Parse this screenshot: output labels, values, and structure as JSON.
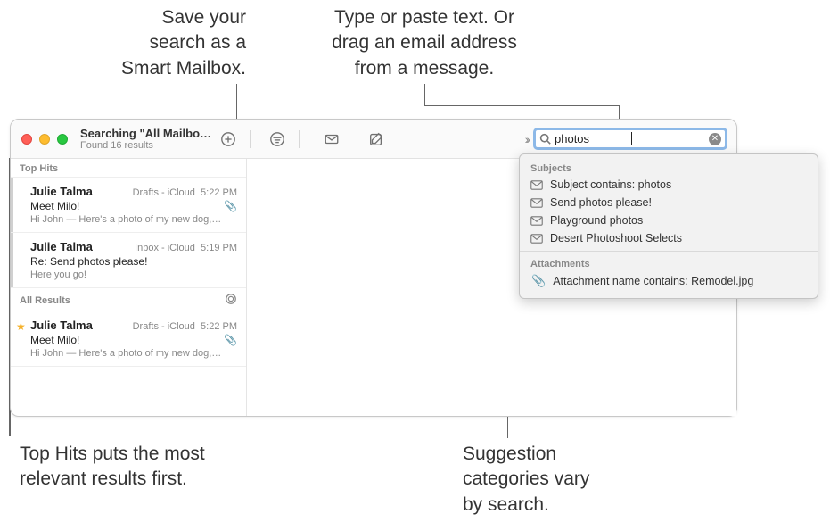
{
  "callouts": {
    "smartMailbox": "Save your\nsearch as a\nSmart Mailbox.",
    "searchHint": "Type or paste text. Or\ndrag an email address\nfrom a message.",
    "topHits": "Top Hits puts the most\nrelevant results first.",
    "suggestions": "Suggestion\ncategories vary\nby search."
  },
  "window": {
    "title": "Searching \"All Mailbo…",
    "subtitle": "Found 16 results"
  },
  "search": {
    "value": "photos"
  },
  "sections": {
    "topHits": "Top Hits",
    "allResults": "All Results"
  },
  "messages": {
    "topHits": [
      {
        "sender": "Julie Talma",
        "folder": "Drafts - iCloud",
        "time": "5:22 PM",
        "subject": "Meet Milo!",
        "hasAttachment": true,
        "preview": "Hi John — Here's a photo of my new dog,…"
      },
      {
        "sender": "Julie Talma",
        "folder": "Inbox - iCloud",
        "time": "5:19 PM",
        "subject": "Re: Send photos please!",
        "hasAttachment": false,
        "preview": "Here you go!"
      }
    ],
    "allResults": [
      {
        "starred": true,
        "sender": "Julie Talma",
        "folder": "Drafts - iCloud",
        "time": "5:22 PM",
        "subject": "Meet Milo!",
        "hasAttachment": true,
        "preview": "Hi John — Here's a photo of my new dog,…"
      }
    ]
  },
  "popover": {
    "subjectsHeader": "Subjects",
    "subjects": [
      "Subject contains: photos",
      "Send photos please!",
      "Playground photos",
      "Desert Photoshoot Selects"
    ],
    "attachmentsHeader": "Attachments",
    "attachments": [
      "Attachment name contains: Remodel.jpg"
    ]
  }
}
